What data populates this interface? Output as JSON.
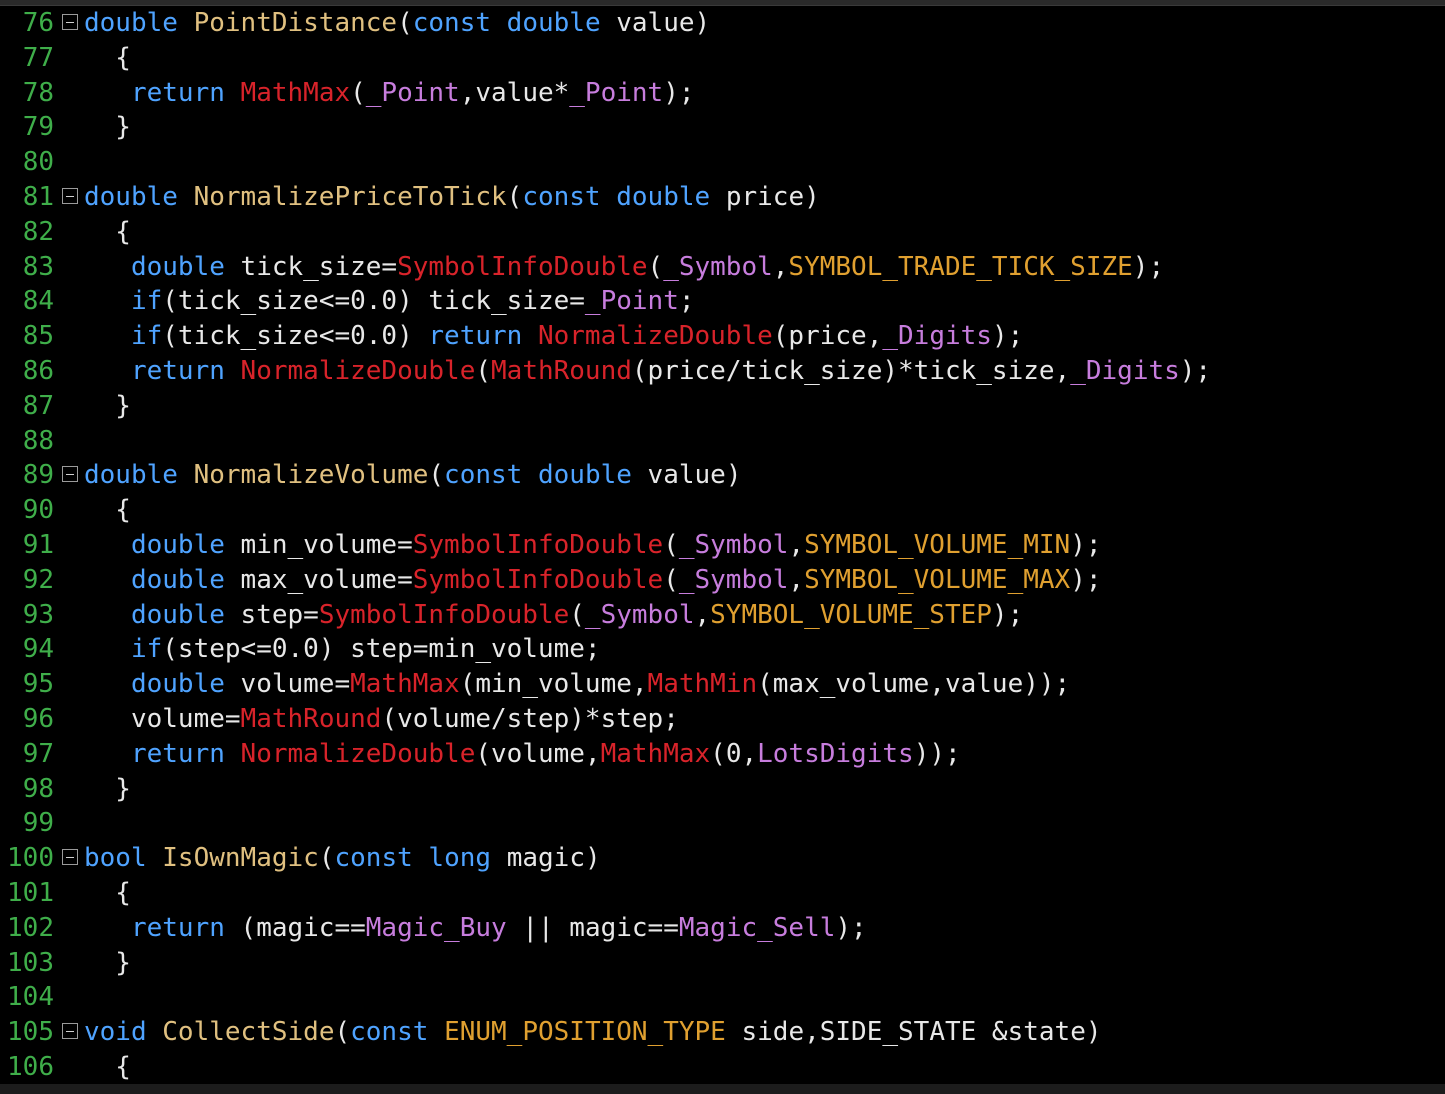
{
  "editor": {
    "colors": {
      "background": "#000000",
      "line_number": "#3fae4a",
      "keyword": "#4fa3ff",
      "function_name": "#e0c080",
      "builtin_function": "#d8232a",
      "predefined_variable": "#c77ddd",
      "constant": "#e0a030",
      "plain_text": "#e8e8e8"
    },
    "lines": [
      {
        "num": "76",
        "fold": true,
        "tokens": [
          [
            "kw",
            "double"
          ],
          [
            "pl",
            " "
          ],
          [
            "fn",
            "PointDistance"
          ],
          [
            "pl",
            "("
          ],
          [
            "kw",
            "const"
          ],
          [
            "pl",
            " "
          ],
          [
            "kw",
            "double"
          ],
          [
            "pl",
            " value)"
          ]
        ]
      },
      {
        "num": "77",
        "fold": false,
        "tokens": [
          [
            "pl",
            "  {"
          ]
        ]
      },
      {
        "num": "78",
        "fold": false,
        "tokens": [
          [
            "pl",
            "   "
          ],
          [
            "kw",
            "return"
          ],
          [
            "pl",
            " "
          ],
          [
            "bi",
            "MathMax"
          ],
          [
            "pl",
            "("
          ],
          [
            "pv",
            "_Point"
          ],
          [
            "pl",
            ",value*"
          ],
          [
            "pv",
            "_Point"
          ],
          [
            "pl",
            ");"
          ]
        ]
      },
      {
        "num": "79",
        "fold": false,
        "tokens": [
          [
            "pl",
            "  }"
          ]
        ]
      },
      {
        "num": "80",
        "fold": false,
        "tokens": []
      },
      {
        "num": "81",
        "fold": true,
        "tokens": [
          [
            "kw",
            "double"
          ],
          [
            "pl",
            " "
          ],
          [
            "fn",
            "NormalizePriceToTick"
          ],
          [
            "pl",
            "("
          ],
          [
            "kw",
            "const"
          ],
          [
            "pl",
            " "
          ],
          [
            "kw",
            "double"
          ],
          [
            "pl",
            " price)"
          ]
        ]
      },
      {
        "num": "82",
        "fold": false,
        "tokens": [
          [
            "pl",
            "  {"
          ]
        ]
      },
      {
        "num": "83",
        "fold": false,
        "tokens": [
          [
            "pl",
            "   "
          ],
          [
            "kw",
            "double"
          ],
          [
            "pl",
            " tick_size="
          ],
          [
            "bi",
            "SymbolInfoDouble"
          ],
          [
            "pl",
            "("
          ],
          [
            "pv",
            "_Symbol"
          ],
          [
            "pl",
            ","
          ],
          [
            "cn",
            "SYMBOL_TRADE_TICK_SIZE"
          ],
          [
            "pl",
            ");"
          ]
        ]
      },
      {
        "num": "84",
        "fold": false,
        "tokens": [
          [
            "pl",
            "   "
          ],
          [
            "kw",
            "if"
          ],
          [
            "pl",
            "(tick_size<=0.0) tick_size="
          ],
          [
            "pv",
            "_Point"
          ],
          [
            "pl",
            ";"
          ]
        ]
      },
      {
        "num": "85",
        "fold": false,
        "tokens": [
          [
            "pl",
            "   "
          ],
          [
            "kw",
            "if"
          ],
          [
            "pl",
            "(tick_size<=0.0) "
          ],
          [
            "kw",
            "return"
          ],
          [
            "pl",
            " "
          ],
          [
            "bi",
            "NormalizeDouble"
          ],
          [
            "pl",
            "(price,"
          ],
          [
            "pv",
            "_Digits"
          ],
          [
            "pl",
            ");"
          ]
        ]
      },
      {
        "num": "86",
        "fold": false,
        "tokens": [
          [
            "pl",
            "   "
          ],
          [
            "kw",
            "return"
          ],
          [
            "pl",
            " "
          ],
          [
            "bi",
            "NormalizeDouble"
          ],
          [
            "pl",
            "("
          ],
          [
            "bi",
            "MathRound"
          ],
          [
            "pl",
            "(price/tick_size)*tick_size,"
          ],
          [
            "pv",
            "_Digits"
          ],
          [
            "pl",
            ");"
          ]
        ]
      },
      {
        "num": "87",
        "fold": false,
        "tokens": [
          [
            "pl",
            "  }"
          ]
        ]
      },
      {
        "num": "88",
        "fold": false,
        "tokens": []
      },
      {
        "num": "89",
        "fold": true,
        "tokens": [
          [
            "kw",
            "double"
          ],
          [
            "pl",
            " "
          ],
          [
            "fn",
            "NormalizeVolume"
          ],
          [
            "pl",
            "("
          ],
          [
            "kw",
            "const"
          ],
          [
            "pl",
            " "
          ],
          [
            "kw",
            "double"
          ],
          [
            "pl",
            " value)"
          ]
        ]
      },
      {
        "num": "90",
        "fold": false,
        "tokens": [
          [
            "pl",
            "  {"
          ]
        ]
      },
      {
        "num": "91",
        "fold": false,
        "tokens": [
          [
            "pl",
            "   "
          ],
          [
            "kw",
            "double"
          ],
          [
            "pl",
            " min_volume="
          ],
          [
            "bi",
            "SymbolInfoDouble"
          ],
          [
            "pl",
            "("
          ],
          [
            "pv",
            "_Symbol"
          ],
          [
            "pl",
            ","
          ],
          [
            "cn",
            "SYMBOL_VOLUME_MIN"
          ],
          [
            "pl",
            ");"
          ]
        ]
      },
      {
        "num": "92",
        "fold": false,
        "tokens": [
          [
            "pl",
            "   "
          ],
          [
            "kw",
            "double"
          ],
          [
            "pl",
            " max_volume="
          ],
          [
            "bi",
            "SymbolInfoDouble"
          ],
          [
            "pl",
            "("
          ],
          [
            "pv",
            "_Symbol"
          ],
          [
            "pl",
            ","
          ],
          [
            "cn",
            "SYMBOL_VOLUME_MAX"
          ],
          [
            "pl",
            ");"
          ]
        ]
      },
      {
        "num": "93",
        "fold": false,
        "tokens": [
          [
            "pl",
            "   "
          ],
          [
            "kw",
            "double"
          ],
          [
            "pl",
            " step="
          ],
          [
            "bi",
            "SymbolInfoDouble"
          ],
          [
            "pl",
            "("
          ],
          [
            "pv",
            "_Symbol"
          ],
          [
            "pl",
            ","
          ],
          [
            "cn",
            "SYMBOL_VOLUME_STEP"
          ],
          [
            "pl",
            ");"
          ]
        ]
      },
      {
        "num": "94",
        "fold": false,
        "tokens": [
          [
            "pl",
            "   "
          ],
          [
            "kw",
            "if"
          ],
          [
            "pl",
            "(step<=0.0) step=min_volume;"
          ]
        ]
      },
      {
        "num": "95",
        "fold": false,
        "tokens": [
          [
            "pl",
            "   "
          ],
          [
            "kw",
            "double"
          ],
          [
            "pl",
            " volume="
          ],
          [
            "bi",
            "MathMax"
          ],
          [
            "pl",
            "(min_volume,"
          ],
          [
            "bi",
            "MathMin"
          ],
          [
            "pl",
            "(max_volume,value));"
          ]
        ]
      },
      {
        "num": "96",
        "fold": false,
        "tokens": [
          [
            "pl",
            "   volume="
          ],
          [
            "bi",
            "MathRound"
          ],
          [
            "pl",
            "(volume/step)*step;"
          ]
        ]
      },
      {
        "num": "97",
        "fold": false,
        "tokens": [
          [
            "pl",
            "   "
          ],
          [
            "kw",
            "return"
          ],
          [
            "pl",
            " "
          ],
          [
            "bi",
            "NormalizeDouble"
          ],
          [
            "pl",
            "(volume,"
          ],
          [
            "bi",
            "MathMax"
          ],
          [
            "pl",
            "(0,"
          ],
          [
            "pv",
            "LotsDigits"
          ],
          [
            "pl",
            "));"
          ]
        ]
      },
      {
        "num": "98",
        "fold": false,
        "tokens": [
          [
            "pl",
            "  }"
          ]
        ]
      },
      {
        "num": "99",
        "fold": false,
        "tokens": []
      },
      {
        "num": "100",
        "fold": true,
        "tokens": [
          [
            "kw",
            "bool"
          ],
          [
            "pl",
            " "
          ],
          [
            "fn",
            "IsOwnMagic"
          ],
          [
            "pl",
            "("
          ],
          [
            "kw",
            "const"
          ],
          [
            "pl",
            " "
          ],
          [
            "kw",
            "long"
          ],
          [
            "pl",
            " magic)"
          ]
        ]
      },
      {
        "num": "101",
        "fold": false,
        "tokens": [
          [
            "pl",
            "  {"
          ]
        ]
      },
      {
        "num": "102",
        "fold": false,
        "tokens": [
          [
            "pl",
            "   "
          ],
          [
            "kw",
            "return"
          ],
          [
            "pl",
            " (magic=="
          ],
          [
            "pv",
            "Magic_Buy"
          ],
          [
            "pl",
            " || magic=="
          ],
          [
            "pv",
            "Magic_Sell"
          ],
          [
            "pl",
            ");"
          ]
        ]
      },
      {
        "num": "103",
        "fold": false,
        "tokens": [
          [
            "pl",
            "  }"
          ]
        ]
      },
      {
        "num": "104",
        "fold": false,
        "tokens": []
      },
      {
        "num": "105",
        "fold": true,
        "tokens": [
          [
            "kw",
            "void"
          ],
          [
            "pl",
            " "
          ],
          [
            "fn",
            "CollectSide"
          ],
          [
            "pl",
            "("
          ],
          [
            "kw",
            "const"
          ],
          [
            "pl",
            " "
          ],
          [
            "cn",
            "ENUM_POSITION_TYPE"
          ],
          [
            "pl",
            " side,SIDE_STATE &state)"
          ]
        ]
      },
      {
        "num": "106",
        "fold": false,
        "tokens": [
          [
            "pl",
            "  {"
          ]
        ]
      }
    ]
  }
}
